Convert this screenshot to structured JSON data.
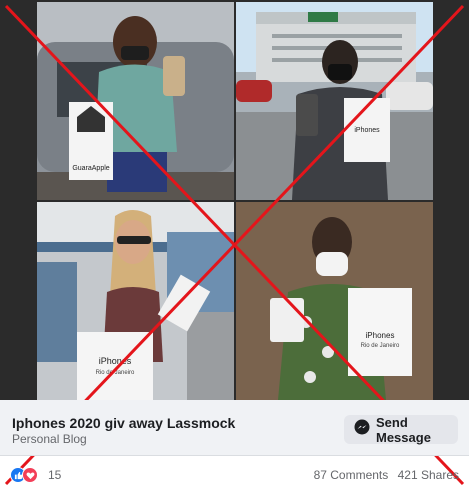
{
  "post": {
    "title": "Iphones 2020 giv away Lassmock",
    "subtitle": "Personal Blog"
  },
  "action_button": {
    "label": "Send Message",
    "icon": "messenger-icon"
  },
  "reactions": {
    "icons": [
      "like-icon",
      "love-icon"
    ],
    "count": "15"
  },
  "stats": {
    "comments": "87 Comments",
    "shares": "421 Shares"
  },
  "photos": {
    "tile_1_bag_text": "GuaraApple",
    "tile_2_bag_text": "iPhones",
    "tile_3_bag_text": "iPhones",
    "tile_3_bag_subtext": "Rio de Janeiro",
    "tile_4_bag_text": "iPhones",
    "tile_4_bag_subtext": "Rio de Janeiro"
  },
  "colors": {
    "cross": "#e4151b",
    "facebook_blue": "#1877f2",
    "love_red": "#f33e58"
  }
}
